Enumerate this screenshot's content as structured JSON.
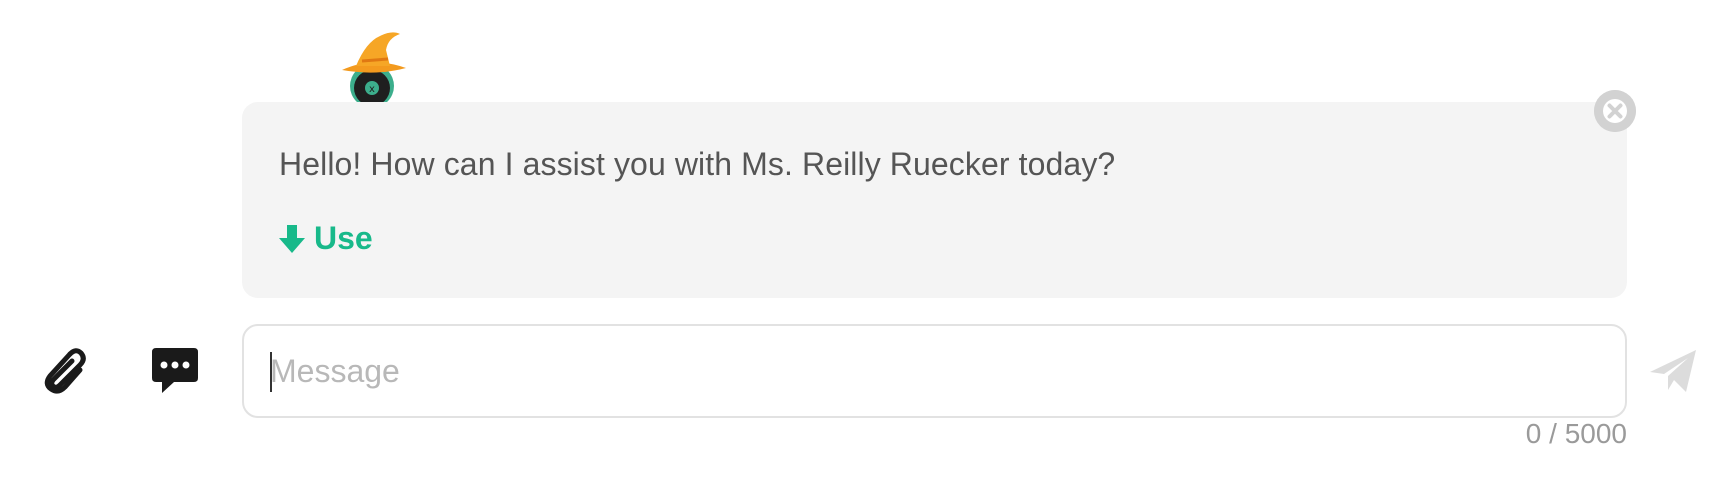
{
  "suggestion": {
    "text": "Hello! How can I assist you with Ms. Reilly Ruecker today?",
    "use_label": "Use"
  },
  "composer": {
    "placeholder": "Message",
    "value": "",
    "char_count": "0 / 5000"
  },
  "icons": {
    "mascot": "wizard-hat-robot-mascot",
    "use": "arrow-down-icon",
    "close": "close-circle-icon",
    "attach": "paperclip-icon",
    "prompts": "chat-bubble-dots-icon",
    "send": "send-paper-plane-icon"
  },
  "colors": {
    "accent": "#18b98a",
    "bubble_bg": "#f4f4f4",
    "text": "#555555",
    "placeholder": "#b8b8b8",
    "muted": "#9a9a9a"
  }
}
